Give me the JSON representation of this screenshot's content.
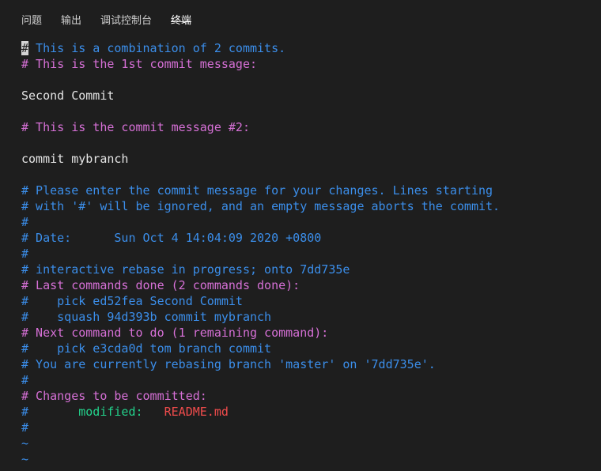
{
  "tabs": [
    {
      "label": "问题"
    },
    {
      "label": "输出"
    },
    {
      "label": "调试控制台"
    },
    {
      "label": "终端"
    }
  ],
  "terminal": {
    "l1_cursor": "#",
    "l1_rest": " This is a combination of 2 commits.",
    "l2": "# This is the 1st commit message:",
    "l3": "",
    "l4": "Second Commit",
    "l5": "",
    "l6": "# This is the commit message #2:",
    "l7": "",
    "l8": "commit mybranch",
    "l9": "",
    "l10": "# Please enter the commit message for your changes. Lines starting",
    "l11": "# with '#' will be ignored, and an empty message aborts the commit.",
    "l12": "#",
    "l13": "# Date:      Sun Oct 4 14:04:09 2020 +0800",
    "l14": "#",
    "l15": "# interactive rebase in progress; onto 7dd735e",
    "l16": "# Last commands done (2 commands done):",
    "l17": "#    pick ed52fea Second Commit",
    "l18": "#    squash 94d393b commit mybranch",
    "l19": "# Next command to do (1 remaining command):",
    "l20": "#    pick e3cda0d tom branch commit",
    "l21": "# You are currently rebasing branch 'master' on '7dd735e'.",
    "l22": "#",
    "l23": "# Changes to be committed:",
    "l24_hash": "#",
    "l24_status": "modified:",
    "l24_file": "README.md",
    "l25": "#",
    "l26": "~",
    "l27": "~"
  },
  "colors": {
    "background": "#1e1e1e",
    "comment_blue": "#3b8eea",
    "comment_magenta": "#d670d6",
    "text_white": "#e5e5e5",
    "status_green": "#23d18b",
    "file_red": "#f14c4c"
  }
}
